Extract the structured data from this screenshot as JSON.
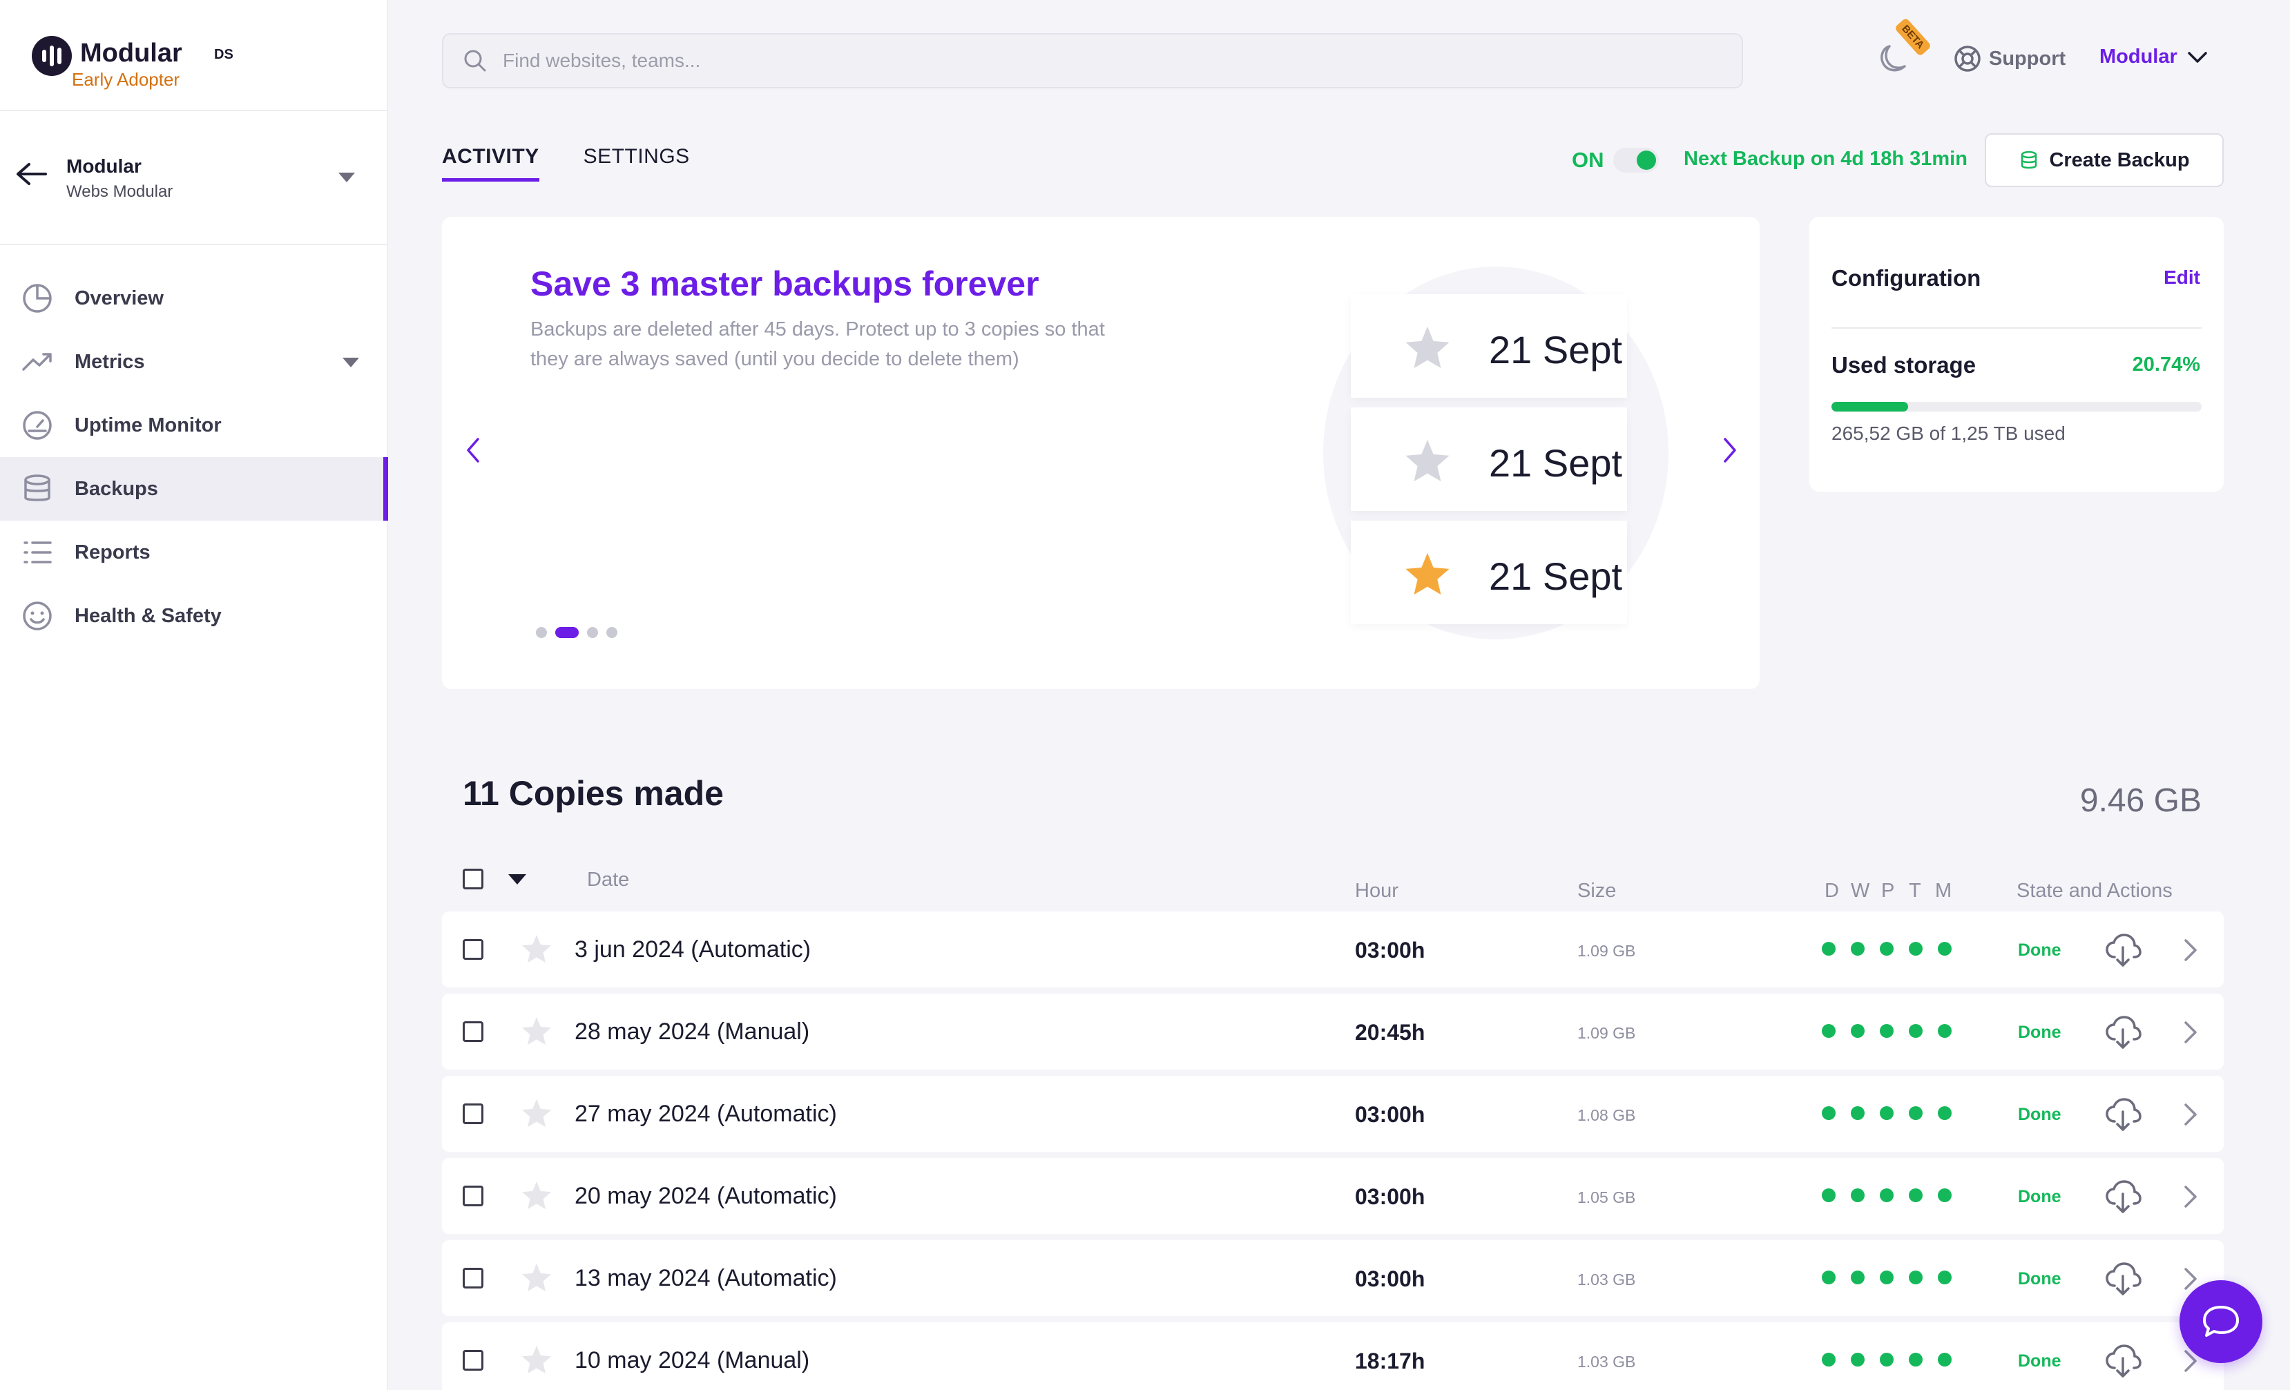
{
  "brand": {
    "name": "Modular",
    "superscript": "DS",
    "tier": "Early Adopter"
  },
  "account": {
    "name": "Modular",
    "subtitle": "Webs Modular"
  },
  "sidebar": {
    "items": [
      {
        "label": "Overview",
        "icon": "pie-chart-icon",
        "active": false
      },
      {
        "label": "Metrics",
        "icon": "trend-up-icon",
        "active": false,
        "expandable": true
      },
      {
        "label": "Uptime Monitor",
        "icon": "gauge-icon",
        "active": false
      },
      {
        "label": "Backups",
        "icon": "database-icon",
        "active": true
      },
      {
        "label": "Reports",
        "icon": "list-icon",
        "active": false
      },
      {
        "label": "Health & Safety",
        "icon": "smiley-icon",
        "active": false
      }
    ]
  },
  "topbar": {
    "search_placeholder": "Find websites, teams...",
    "beta_badge": "BETA",
    "support_label": "Support",
    "user_label": "Modular"
  },
  "tabs": [
    {
      "label": "ACTIVITY",
      "active": true
    },
    {
      "label": "SETTINGS",
      "active": false
    }
  ],
  "backup_controls": {
    "toggle_label": "ON",
    "toggle_on": true,
    "next_backup": "Next Backup on 4d 18h 31min",
    "create_label": "Create Backup"
  },
  "promo": {
    "title": "Save 3 master backups forever",
    "description": "Backups are deleted after 45 days. Protect up to 3 copies so that they are always saved (until you decide to delete them)",
    "sample_dates": [
      "21 Sept",
      "21 Sept",
      "21 Sept"
    ],
    "starred": [
      false,
      false,
      true
    ],
    "slides": 4,
    "active_slide": 1
  },
  "configuration": {
    "title": "Configuration",
    "edit_label": "Edit",
    "storage_label": "Used storage",
    "storage_percent": "20.74%",
    "storage_fraction": 0.2074,
    "storage_used_text": "265,52 GB of 1,25 TB used"
  },
  "copies": {
    "title": "11 Copies made",
    "total_size": "9.46 GB",
    "columns": {
      "date": "Date",
      "hour": "Hour",
      "size": "Size",
      "dots": [
        "D",
        "W",
        "P",
        "T",
        "M"
      ],
      "state": "State and Actions"
    },
    "rows": [
      {
        "date": "3 jun 2024 (Automatic)",
        "hour": "03:00h",
        "size": "1.09 GB",
        "state": "Done"
      },
      {
        "date": "28 may 2024 (Manual)",
        "hour": "20:45h",
        "size": "1.09 GB",
        "state": "Done"
      },
      {
        "date": "27 may 2024 (Automatic)",
        "hour": "03:00h",
        "size": "1.08 GB",
        "state": "Done"
      },
      {
        "date": "20 may 2024 (Automatic)",
        "hour": "03:00h",
        "size": "1.05 GB",
        "state": "Done"
      },
      {
        "date": "13 may 2024 (Automatic)",
        "hour": "03:00h",
        "size": "1.03 GB",
        "state": "Done"
      },
      {
        "date": "10 may 2024 (Manual)",
        "hour": "18:17h",
        "size": "1.03 GB",
        "state": "Done"
      }
    ]
  },
  "colors": {
    "accent": "#6c1ee6",
    "success": "#14b85a",
    "star_active": "#f6a93b",
    "star_inactive": "#d6d6de"
  }
}
